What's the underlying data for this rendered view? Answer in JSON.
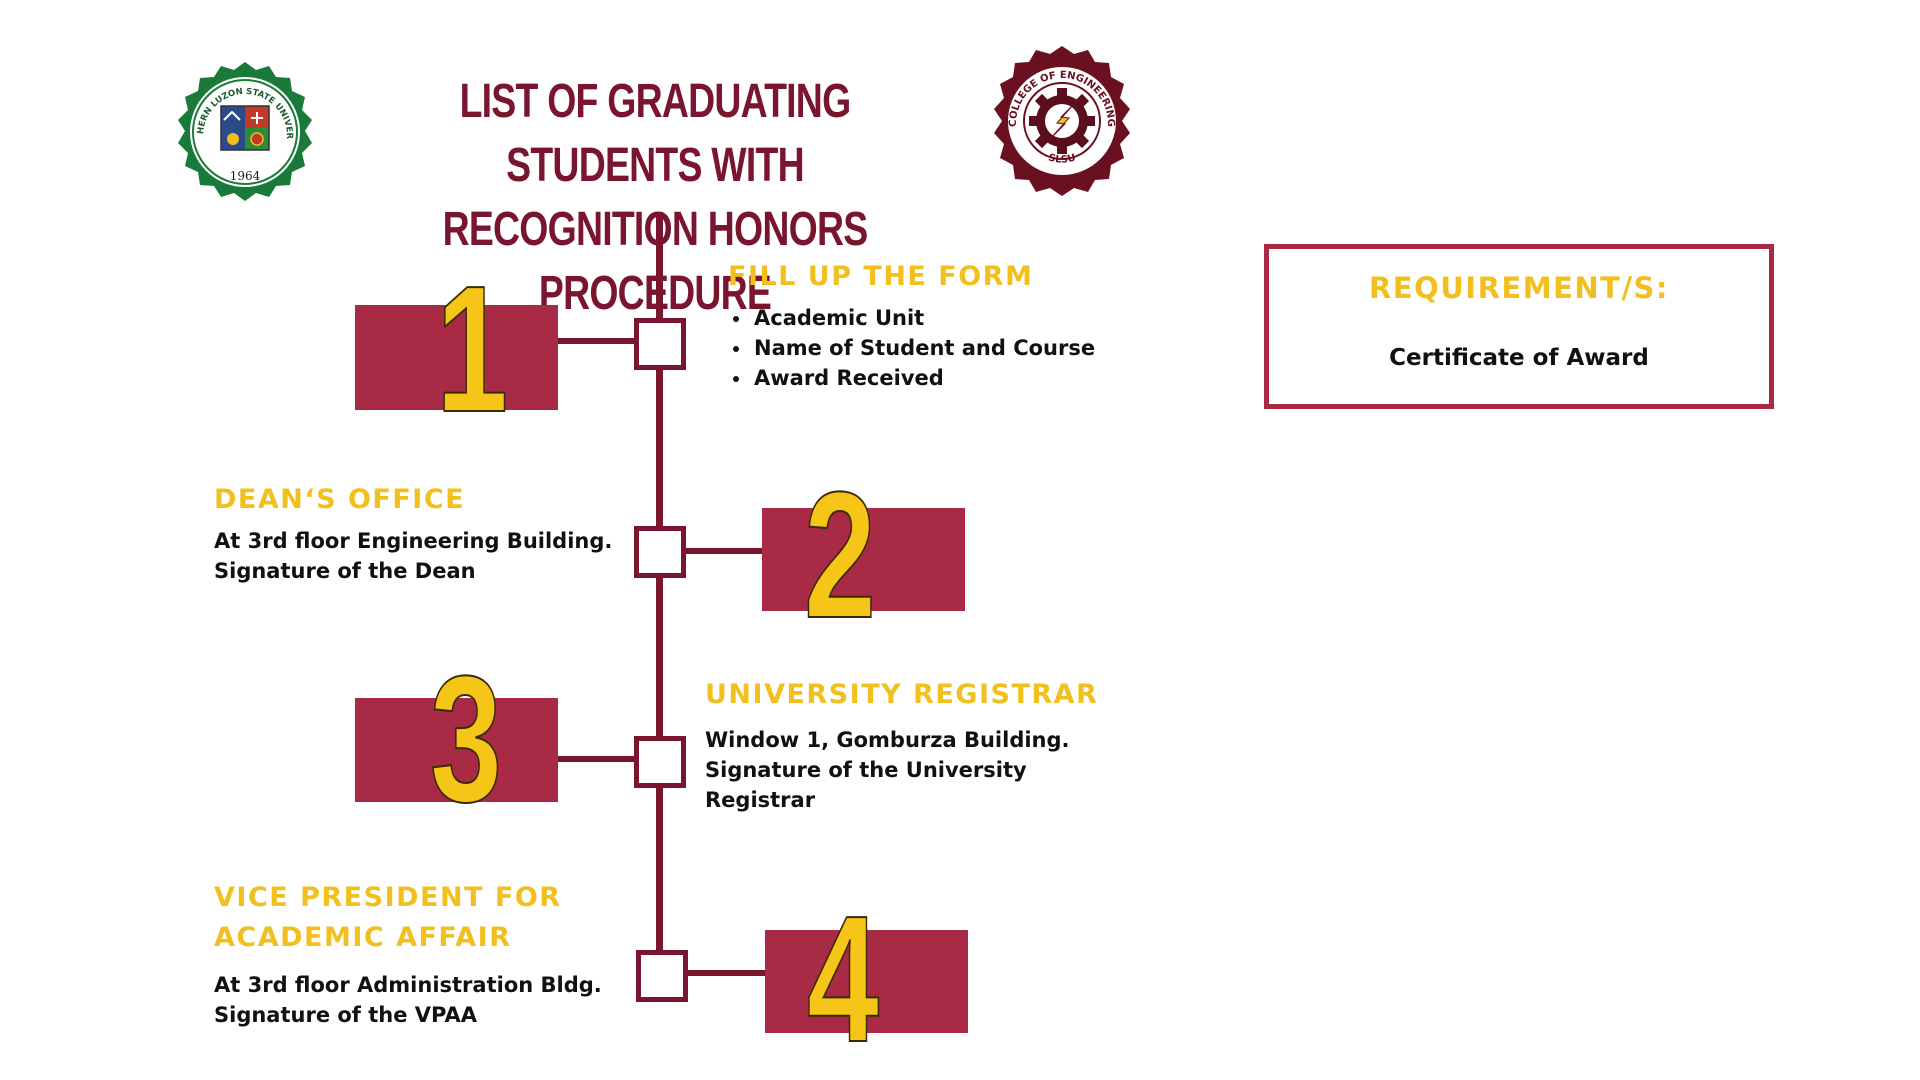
{
  "header": {
    "title_line1": "LIST OF GRADUATING STUDENTS WITH",
    "title_line2": "RECOGNITION HONORS PROCEDURE",
    "left_logo": {
      "text_top": "SOUTHERN LUZON STATE UNIVERSITY",
      "year": "1964",
      "colors": {
        "ring": "#1a7a3a",
        "shield_blue": "#2a4a8a",
        "shield_red": "#c0392b",
        "shield_green": "#2e8b3a"
      }
    },
    "right_logo": {
      "text_top": "COLLEGE OF ENGINEERING",
      "text_bottom": "SLSU",
      "colors": {
        "ring": "#6b1020",
        "bolt": "#f2c01e"
      }
    }
  },
  "steps": [
    {
      "number": "1",
      "title": "FILL UP THE FORM",
      "bullets": [
        "Academic Unit",
        "Name of Student and Course",
        "Award Received"
      ]
    },
    {
      "number": "2",
      "title": "DEAN‘S OFFICE",
      "lines": [
        "At 3rd floor Engineering Building.",
        "Signature of the Dean"
      ]
    },
    {
      "number": "3",
      "title": "UNIVERSITY REGISTRAR",
      "lines": [
        "Window 1, Gomburza Building.",
        "Signature of the University",
        "Registrar"
      ]
    },
    {
      "number": "4",
      "title_lines": [
        "VICE PRESIDENT FOR",
        "ACADEMIC AFFAIR"
      ],
      "lines": [
        "At 3rd floor Administration Bldg.",
        "Signature of the VPAA"
      ]
    }
  ],
  "requirements": {
    "title": "REQUIREMENT/S:",
    "items": [
      "Certificate of Award"
    ]
  },
  "colors": {
    "maroon": "#7a1530",
    "bar": "#a82a45",
    "gold": "#f2c01e",
    "text": "#111111"
  }
}
